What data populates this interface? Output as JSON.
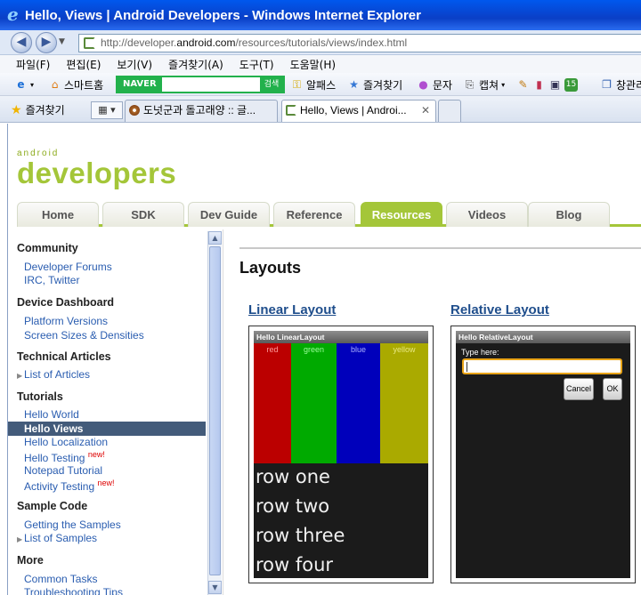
{
  "window": {
    "title": "Hello, Views | Android Developers - Windows Internet Explorer",
    "address": {
      "prefix": "http://developer.",
      "host": "android.com",
      "path": "/resources/tutorials/views/index.html"
    }
  },
  "menu": [
    "파일(F)",
    "편집(E)",
    "보기(V)",
    "즐겨찾기(A)",
    "도구(T)",
    "도움말(H)"
  ],
  "toolbar": {
    "home_label": "스마트홈",
    "naver_logo": "NAVER",
    "naver_go": "검색",
    "alpass": "알패스",
    "favorites": "즐겨찾기",
    "sms": "문자",
    "capture": "캡쳐",
    "new_window": "창관리"
  },
  "tabbar": {
    "favorites_label": "즐겨찾기",
    "tab1": "도넛군과 돌고래양 :: 글...",
    "tab2": "Hello, Views | Androi...",
    "close": "✕"
  },
  "brand": {
    "small": "android",
    "large": "developers"
  },
  "nav_tabs": [
    "Home",
    "SDK",
    "Dev Guide",
    "Reference",
    "Resources",
    "Videos",
    "Blog"
  ],
  "sidebar": {
    "community": "Community",
    "forums": "Developer Forums",
    "irc": "IRC, Twitter",
    "dashboard": "Device Dashboard",
    "platforms": "Platform Versions",
    "screens": "Screen Sizes & Densities",
    "tech": "Technical Articles",
    "articles": "List of Articles",
    "tutorials": "Tutorials",
    "hello_world": "Hello World",
    "hello_views": "Hello Views",
    "hello_loc": "Hello Localization",
    "hello_testing": "Hello Testing",
    "notepad": "Notepad Tutorial",
    "activity_testing": "Activity Testing",
    "new_badge": "new!",
    "sample_code": "Sample Code",
    "getting_samples": "Getting the Samples",
    "list_samples": "List of Samples",
    "more": "More",
    "common_tasks": "Common Tasks",
    "troubleshooting": "Troubleshooting Tips"
  },
  "main": {
    "heading": "Layouts",
    "linear": {
      "title": "Linear Layout",
      "screen_title": "Hello LinearLayout",
      "columns": [
        {
          "label": "red",
          "color": "#bb0000"
        },
        {
          "label": "green",
          "color": "#00aa00"
        },
        {
          "label": "blue",
          "color": "#0000bb"
        },
        {
          "label": "yellow",
          "color": "#aaaa00"
        }
      ],
      "rows": [
        "row one",
        "row two",
        "row three",
        "row four"
      ]
    },
    "relative": {
      "title": "Relative Layout",
      "screen_title": "Hello RelativeLayout",
      "type_label": "Type here:",
      "cancel": "Cancel",
      "ok": "OK"
    }
  },
  "colors": {
    "android_green": "#a4c639",
    "link_blue": "#2a5db0",
    "title_bar": "#0a3fc6"
  }
}
